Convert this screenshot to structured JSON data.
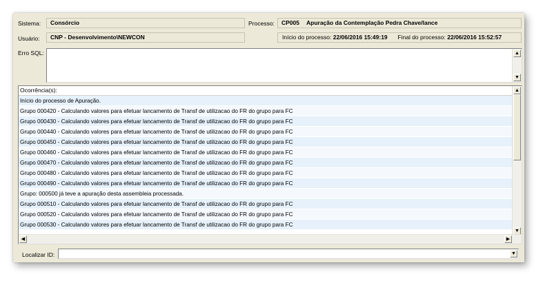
{
  "labels": {
    "sistema": "Sistema:",
    "usuario": "Usuário:",
    "processo": "Processo:",
    "erro_sql": "Erro SQL:",
    "localizar_id": "Localizar ID:"
  },
  "sistema": {
    "value": "Consórcio"
  },
  "usuario": {
    "value": "CNP - Desenvolvimento\\NEWCON"
  },
  "processo": {
    "code": "CP005",
    "name": "Apuração da Contemplação Pedra Chave/lance"
  },
  "times": {
    "inicio_label": "Início do processo:",
    "inicio_value": "22/06/2016 15:49:19",
    "final_label": "Final do processo:",
    "final_value": "22/06/2016 15:52:57"
  },
  "erro_sql": {
    "value": ""
  },
  "ocorrencias": {
    "header": "Ocorrência(s):",
    "rows": [
      "Início do processo de Apuração.",
      "Grupo 000420 - Calculando valores para efetuar lancamento de Transf de utilizacao do FR do grupo para FC",
      "Grupo 000430 - Calculando valores para efetuar lancamento de Transf de utilizacao do FR do grupo para FC",
      "Grupo 000440 - Calculando valores para efetuar lancamento de Transf de utilizacao do FR do grupo para FC",
      "Grupo 000450 - Calculando valores para efetuar lancamento de Transf de utilizacao do FR do grupo para FC",
      "Grupo 000460 - Calculando valores para efetuar lancamento de Transf de utilizacao do FR do grupo para FC",
      "Grupo 000470 - Calculando valores para efetuar lancamento de Transf de utilizacao do FR do grupo para FC",
      "Grupo 000480 - Calculando valores para efetuar lancamento de Transf de utilizacao do FR do grupo para FC",
      "Grupo 000490 - Calculando valores para efetuar lancamento de Transf de utilizacao do FR do grupo para FC",
      "Grupo: 000500 já teve a apuração desta assembleia processada.",
      "Grupo 000510 - Calculando valores para efetuar lancamento de Transf de utilizacao do FR do grupo para FC",
      "Grupo 000520 - Calculando valores para efetuar lancamento de Transf de utilizacao do FR do grupo para FC",
      "Grupo 000530 - Calculando valores para efetuar lancamento de Transf de utilizacao do FR do grupo para FC"
    ]
  },
  "localizar": {
    "value": ""
  },
  "icons": {
    "up": "▲",
    "down": "▼",
    "left": "◀",
    "right": "▶"
  },
  "colors": {
    "panel": "#ece9d8",
    "row_odd": "#e6f1fb",
    "row_even": "#f5f9fd"
  }
}
